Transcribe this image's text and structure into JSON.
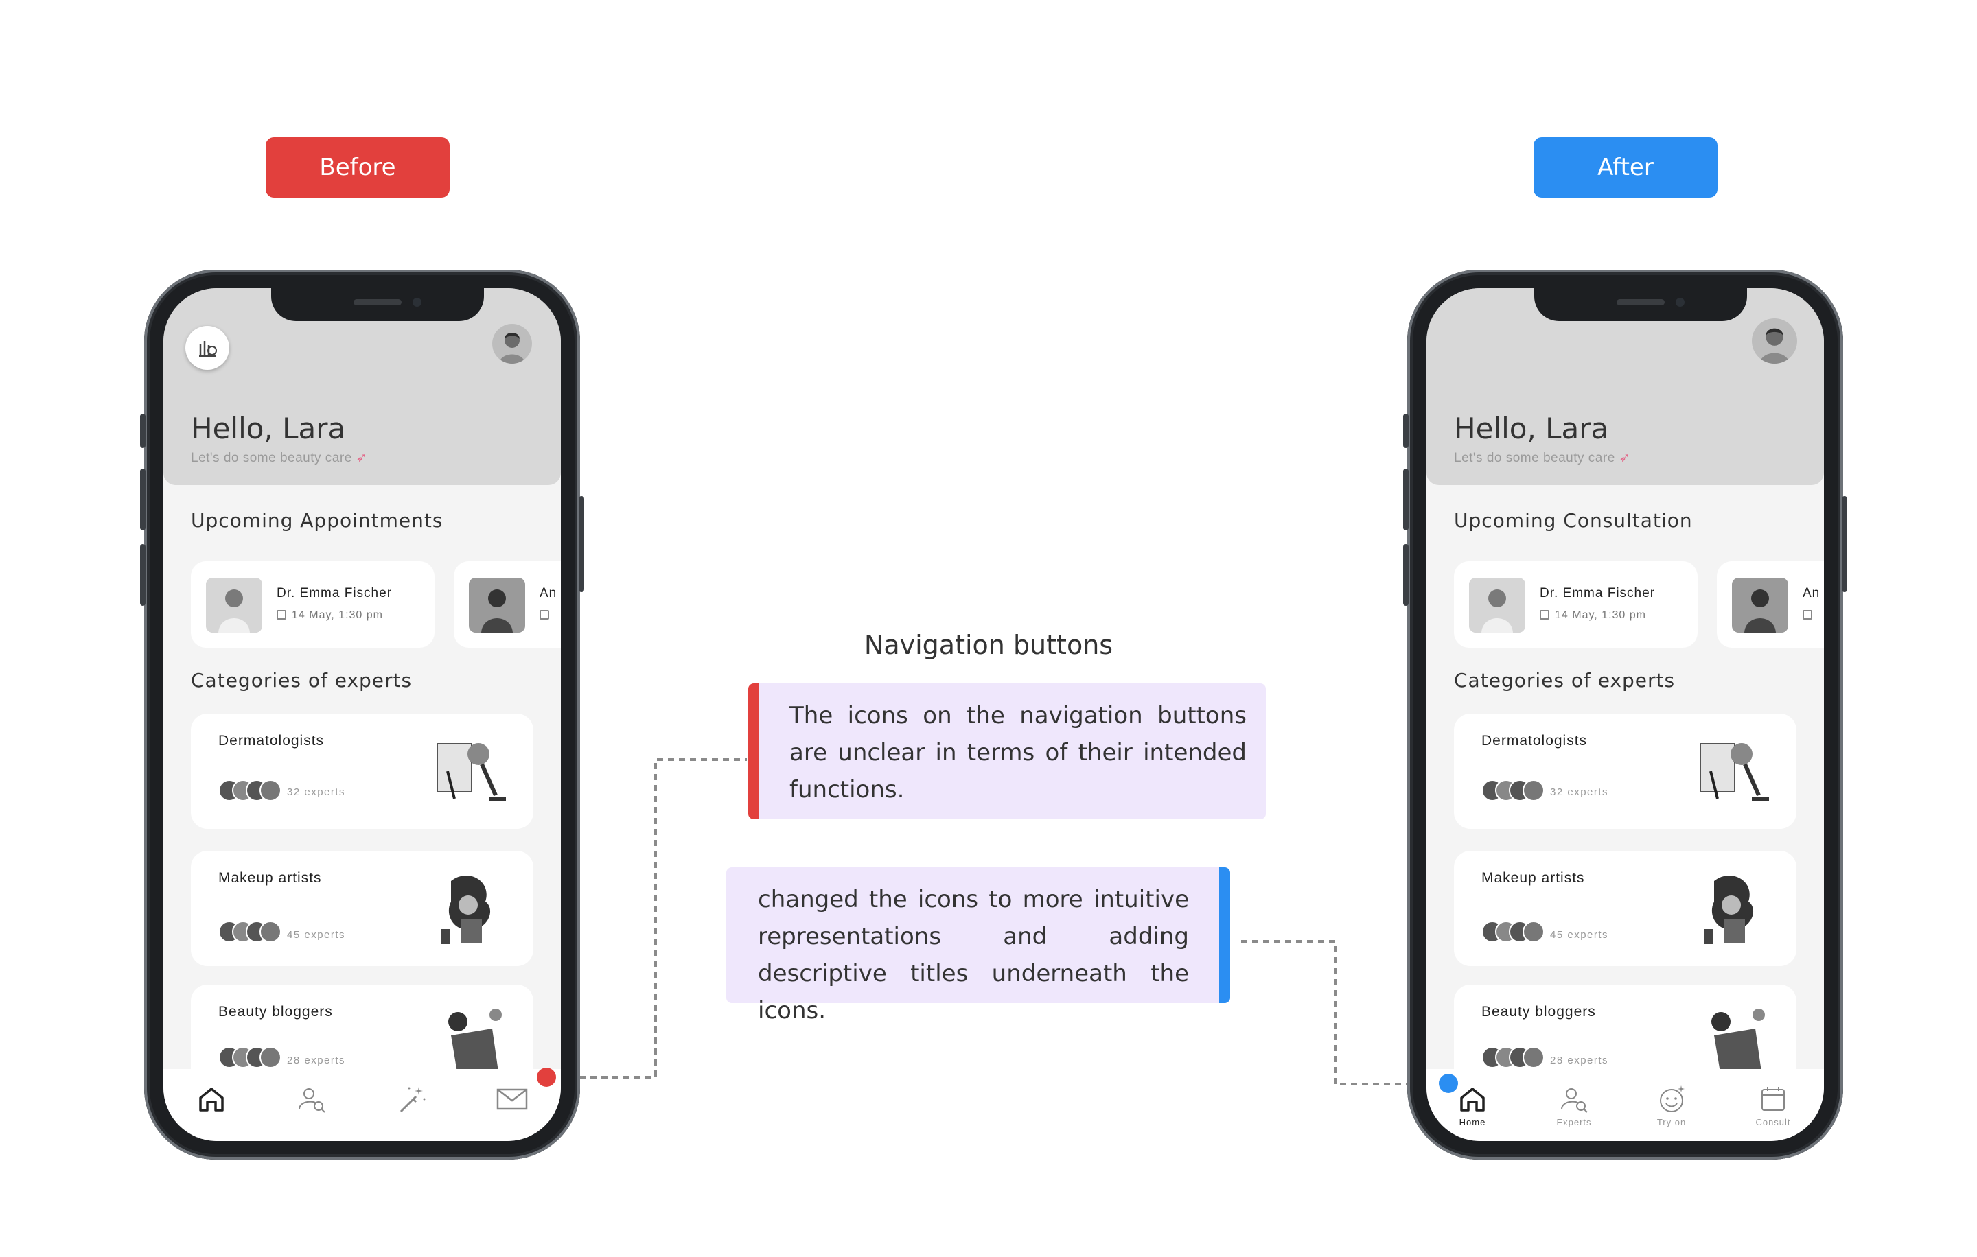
{
  "labels": {
    "before": "Before",
    "after": "After"
  },
  "colors": {
    "before": "#e2403d",
    "after": "#2b8ef2",
    "note_bg": "#efe7fc"
  },
  "annotation": {
    "title": "Navigation buttons",
    "problem": "The icons on the navigation buttons are unclear in terms of their intended functions.",
    "solution": "changed the icons to more intuitive representations and adding descriptive titles underneath the icons."
  },
  "app": {
    "greeting": "Hello, Lara",
    "subtitle": "Let's do some beauty care",
    "subtitle_icon": "rocket-icon",
    "appointments_before": "Upcoming Appointments",
    "appointments_after": "Upcoming Consultation",
    "appointment": {
      "name": "Dr. Emma Fischer",
      "date": "14 May, 1:30 pm"
    },
    "appointment_peek": "An",
    "categories_title": "Categories of experts",
    "categories": [
      {
        "title": "Dermatologists",
        "count": "32 experts",
        "icon": "microscope-illustration"
      },
      {
        "title": "Makeup artists",
        "count": "45 experts",
        "icon": "makeup-artist-illustration"
      },
      {
        "title": "Beauty bloggers",
        "count": "28 experts",
        "icon": "blogger-illustration"
      }
    ],
    "nav_before": [
      "home-icon",
      "search-user-icon",
      "magic-wand-icon",
      "mail-icon"
    ],
    "nav_after": [
      {
        "label": "Home",
        "icon": "home-icon"
      },
      {
        "label": "Experts",
        "icon": "search-user-icon"
      },
      {
        "label": "Try on",
        "icon": "smiley-sparkle-icon"
      },
      {
        "label": "Consult",
        "icon": "calendar-icon"
      }
    ]
  }
}
